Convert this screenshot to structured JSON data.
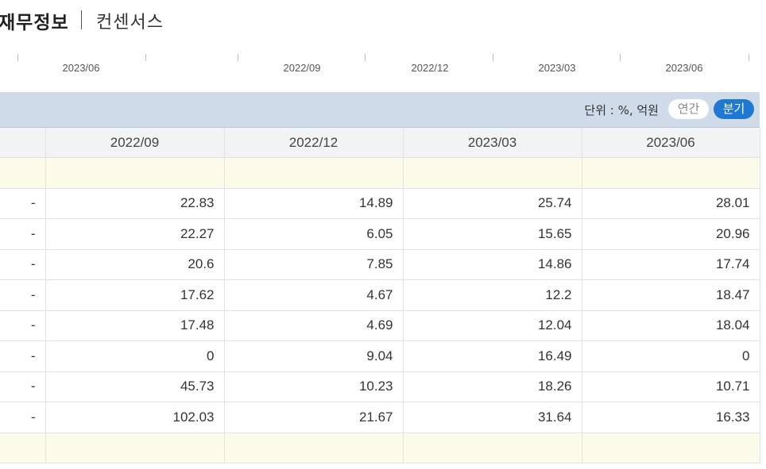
{
  "header": {
    "title": "재무정보",
    "subtitle": "컨센서스"
  },
  "timeline": {
    "labels": [
      "2023/06",
      "2022/09",
      "2022/12",
      "2023/03",
      "2023/06"
    ]
  },
  "unit_bar": {
    "unit_label": "단위 : %, 억원",
    "annual_label": "연간",
    "quarter_label": "분기"
  },
  "table": {
    "columns": [
      "2022/09",
      "2022/12",
      "2023/03",
      "2023/06"
    ],
    "rows": [
      {
        "dash": "-",
        "values": [
          "22.83",
          "14.89",
          "25.74",
          "28.01"
        ]
      },
      {
        "dash": "-",
        "values": [
          "22.27",
          "6.05",
          "15.65",
          "20.96"
        ]
      },
      {
        "dash": "-",
        "values": [
          "20.6",
          "7.85",
          "14.86",
          "17.74"
        ]
      },
      {
        "dash": "-",
        "values": [
          "17.62",
          "4.67",
          "12.2",
          "18.47"
        ]
      },
      {
        "dash": "-",
        "values": [
          "17.48",
          "4.69",
          "12.04",
          "18.04"
        ]
      },
      {
        "dash": "-",
        "values": [
          "0",
          "9.04",
          "16.49",
          "0"
        ]
      },
      {
        "dash": "-",
        "values": [
          "45.73",
          "10.23",
          "18.26",
          "10.71"
        ]
      },
      {
        "dash": "-",
        "values": [
          "102.03",
          "21.67",
          "31.64",
          "16.33"
        ]
      }
    ]
  }
}
